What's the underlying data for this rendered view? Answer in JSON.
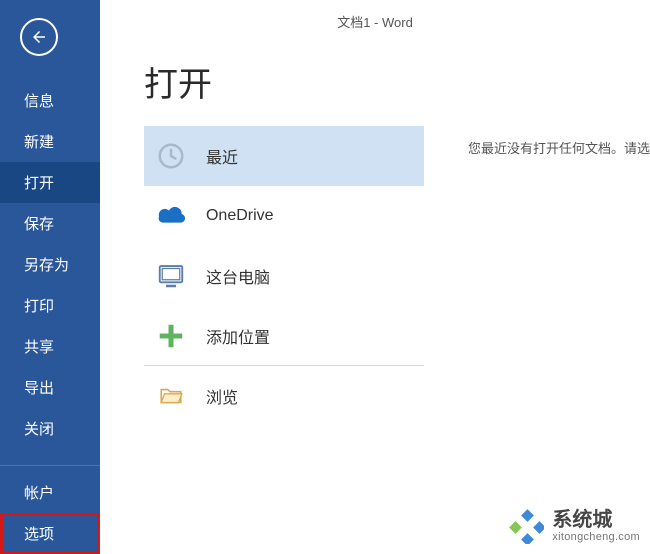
{
  "window": {
    "title": "文档1 - Word"
  },
  "sidebar": {
    "items": [
      {
        "label": "信息"
      },
      {
        "label": "新建"
      },
      {
        "label": "打开",
        "active": true
      },
      {
        "label": "保存"
      },
      {
        "label": "另存为"
      },
      {
        "label": "打印"
      },
      {
        "label": "共享"
      },
      {
        "label": "导出"
      },
      {
        "label": "关闭"
      }
    ],
    "account": "帐户",
    "options": "选项"
  },
  "page": {
    "title": "打开",
    "sources": [
      {
        "id": "recent",
        "label": "最近",
        "selected": true
      },
      {
        "id": "onedrive",
        "label": "OneDrive"
      },
      {
        "id": "computer",
        "label": "这台电脑"
      },
      {
        "id": "addplace",
        "label": "添加位置",
        "dividerBelow": true
      },
      {
        "id": "browse",
        "label": "浏览"
      }
    ],
    "empty_recent": "您最近没有打开任何文档。请选"
  },
  "watermark": {
    "name": "系统城",
    "url": "xitongcheng.com"
  }
}
